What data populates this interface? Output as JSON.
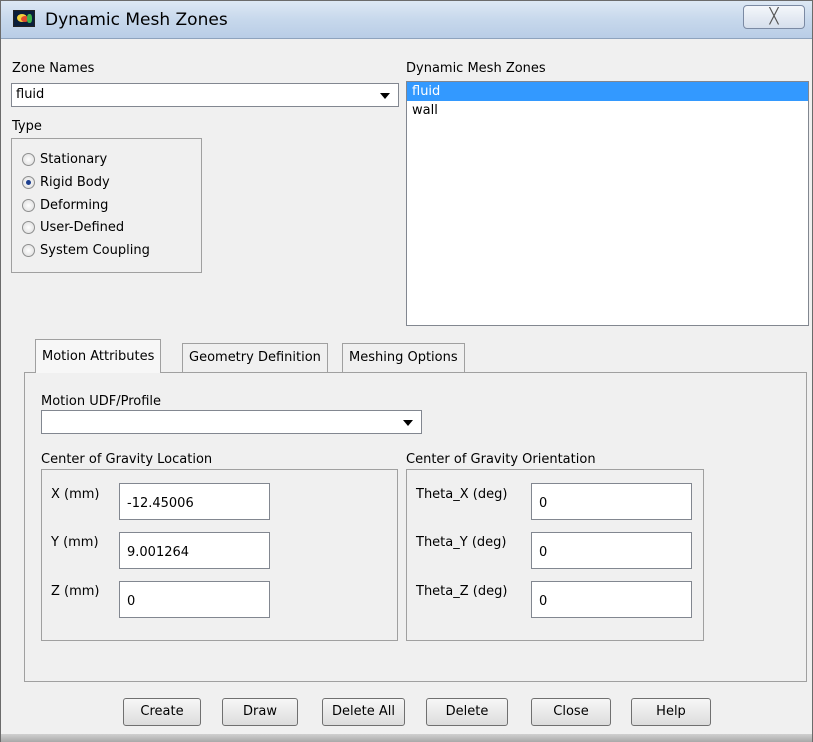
{
  "window": {
    "title": "Dynamic Mesh Zones",
    "close_glyph": "╳"
  },
  "zone_names": {
    "label": "Zone Names",
    "value": "fluid"
  },
  "type": {
    "label": "Type",
    "options": [
      "Stationary",
      "Rigid Body",
      "Deforming",
      "User-Defined",
      "System Coupling"
    ],
    "selected": "Rigid Body"
  },
  "dynamic_mesh_zones": {
    "label": "Dynamic Mesh Zones",
    "items": [
      "fluid",
      "wall"
    ],
    "selected": "fluid"
  },
  "tabs": [
    "Motion Attributes",
    "Geometry Definition",
    "Meshing Options"
  ],
  "active_tab": "Motion Attributes",
  "motion_udf": {
    "label": "Motion UDF/Profile",
    "value": ""
  },
  "cg_location": {
    "label": "Center of Gravity Location",
    "fields": [
      {
        "label": "X (mm)",
        "value": "-12.45006"
      },
      {
        "label": "Y (mm)",
        "value": "9.001264"
      },
      {
        "label": "Z (mm)",
        "value": "0"
      }
    ]
  },
  "cg_orientation": {
    "label": "Center of Gravity Orientation",
    "fields": [
      {
        "label": "Theta_X (deg)",
        "value": "0"
      },
      {
        "label": "Theta_Y (deg)",
        "value": "0"
      },
      {
        "label": "Theta_Z (deg)",
        "value": "0"
      }
    ]
  },
  "buttons": [
    "Create",
    "Draw",
    "Delete All",
    "Delete",
    "Close",
    "Help"
  ]
}
